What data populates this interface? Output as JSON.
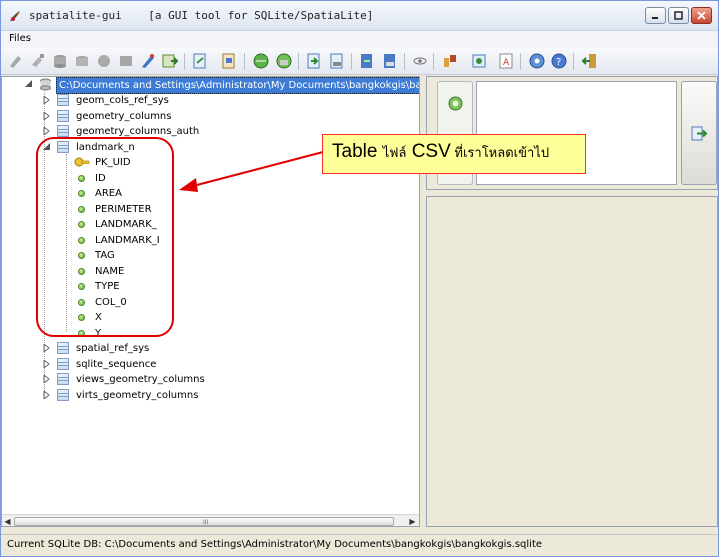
{
  "window": {
    "app_name": "spatialite-gui",
    "subtitle": "[a GUI tool for SQLite/SpatiaLite]",
    "controls": [
      "minimize",
      "maximize",
      "close"
    ]
  },
  "menu": {
    "items": [
      "Files"
    ]
  },
  "toolbar": {
    "icons": [
      "connect-icon",
      "disconnect-icon",
      "db-icon",
      "db-new-icon",
      "db-memory-icon",
      "db-save-icon",
      "plugin-icon",
      "sql-icon",
      "load-shp-icon",
      "virtual-shp-icon",
      "globe-icon",
      "globe-export-icon",
      "import-icon",
      "export-icon",
      "table-load-icon",
      "table-save-icon",
      "eye-icon",
      "chart-icon",
      "map-icon",
      "pdf-icon",
      "help-icon",
      "about-icon",
      "exit-icon"
    ]
  },
  "tree": {
    "root": "C:\\Documents and Settings\\Administrator\\My Documents\\bangkokgis\\bangkokgis.sqlite",
    "tables_before": [
      "geom_cols_ref_sys",
      "geometry_columns",
      "geometry_columns_auth"
    ],
    "expanded_table": "landmark_n",
    "columns": [
      {
        "name": "PK_UID",
        "primary_key": true
      },
      {
        "name": "ID",
        "primary_key": false
      },
      {
        "name": "AREA",
        "primary_key": false
      },
      {
        "name": "PERIMETER",
        "primary_key": false
      },
      {
        "name": "LANDMARK_",
        "primary_key": false
      },
      {
        "name": "LANDMARK_I",
        "primary_key": false
      },
      {
        "name": "TAG",
        "primary_key": false
      },
      {
        "name": "NAME",
        "primary_key": false
      },
      {
        "name": "TYPE",
        "primary_key": false
      },
      {
        "name": "COL_0",
        "primary_key": false
      },
      {
        "name": "X",
        "primary_key": false
      },
      {
        "name": "Y",
        "primary_key": false
      }
    ],
    "tables_after": [
      "spatial_ref_sys",
      "sqlite_sequence",
      "views_geometry_columns",
      "virts_geometry_columns"
    ],
    "scrollbar_grip": "III"
  },
  "annotation": {
    "prefix": "Table ",
    "thai": "ไฟล์",
    "suffix": " CSV",
    "thai_tail": " ที่เราโหลดเข้าไป",
    "color": "#ff0000",
    "box_color": "#ffff99"
  },
  "status": {
    "text": "Current SQLite DB: C:\\Documents and Settings\\Administrator\\My Documents\\bangkokgis\\bangkokgis.sqlite"
  }
}
